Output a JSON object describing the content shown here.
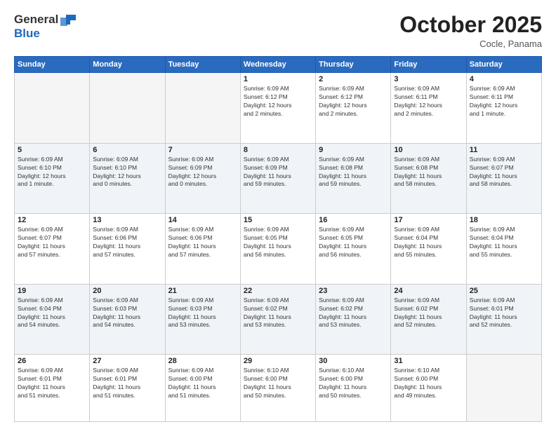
{
  "header": {
    "logo_general": "General",
    "logo_blue": "Blue",
    "month_title": "October 2025",
    "subtitle": "Cocle, Panama"
  },
  "weekdays": [
    "Sunday",
    "Monday",
    "Tuesday",
    "Wednesday",
    "Thursday",
    "Friday",
    "Saturday"
  ],
  "weeks": [
    [
      {
        "day": "",
        "info": ""
      },
      {
        "day": "",
        "info": ""
      },
      {
        "day": "",
        "info": ""
      },
      {
        "day": "1",
        "info": "Sunrise: 6:09 AM\nSunset: 6:12 PM\nDaylight: 12 hours\nand 2 minutes."
      },
      {
        "day": "2",
        "info": "Sunrise: 6:09 AM\nSunset: 6:12 PM\nDaylight: 12 hours\nand 2 minutes."
      },
      {
        "day": "3",
        "info": "Sunrise: 6:09 AM\nSunset: 6:11 PM\nDaylight: 12 hours\nand 2 minutes."
      },
      {
        "day": "4",
        "info": "Sunrise: 6:09 AM\nSunset: 6:11 PM\nDaylight: 12 hours\nand 1 minute."
      }
    ],
    [
      {
        "day": "5",
        "info": "Sunrise: 6:09 AM\nSunset: 6:10 PM\nDaylight: 12 hours\nand 1 minute."
      },
      {
        "day": "6",
        "info": "Sunrise: 6:09 AM\nSunset: 6:10 PM\nDaylight: 12 hours\nand 0 minutes."
      },
      {
        "day": "7",
        "info": "Sunrise: 6:09 AM\nSunset: 6:09 PM\nDaylight: 12 hours\nand 0 minutes."
      },
      {
        "day": "8",
        "info": "Sunrise: 6:09 AM\nSunset: 6:09 PM\nDaylight: 11 hours\nand 59 minutes."
      },
      {
        "day": "9",
        "info": "Sunrise: 6:09 AM\nSunset: 6:08 PM\nDaylight: 11 hours\nand 59 minutes."
      },
      {
        "day": "10",
        "info": "Sunrise: 6:09 AM\nSunset: 6:08 PM\nDaylight: 11 hours\nand 58 minutes."
      },
      {
        "day": "11",
        "info": "Sunrise: 6:09 AM\nSunset: 6:07 PM\nDaylight: 11 hours\nand 58 minutes."
      }
    ],
    [
      {
        "day": "12",
        "info": "Sunrise: 6:09 AM\nSunset: 6:07 PM\nDaylight: 11 hours\nand 57 minutes."
      },
      {
        "day": "13",
        "info": "Sunrise: 6:09 AM\nSunset: 6:06 PM\nDaylight: 11 hours\nand 57 minutes."
      },
      {
        "day": "14",
        "info": "Sunrise: 6:09 AM\nSunset: 6:06 PM\nDaylight: 11 hours\nand 57 minutes."
      },
      {
        "day": "15",
        "info": "Sunrise: 6:09 AM\nSunset: 6:05 PM\nDaylight: 11 hours\nand 56 minutes."
      },
      {
        "day": "16",
        "info": "Sunrise: 6:09 AM\nSunset: 6:05 PM\nDaylight: 11 hours\nand 56 minutes."
      },
      {
        "day": "17",
        "info": "Sunrise: 6:09 AM\nSunset: 6:04 PM\nDaylight: 11 hours\nand 55 minutes."
      },
      {
        "day": "18",
        "info": "Sunrise: 6:09 AM\nSunset: 6:04 PM\nDaylight: 11 hours\nand 55 minutes."
      }
    ],
    [
      {
        "day": "19",
        "info": "Sunrise: 6:09 AM\nSunset: 6:04 PM\nDaylight: 11 hours\nand 54 minutes."
      },
      {
        "day": "20",
        "info": "Sunrise: 6:09 AM\nSunset: 6:03 PM\nDaylight: 11 hours\nand 54 minutes."
      },
      {
        "day": "21",
        "info": "Sunrise: 6:09 AM\nSunset: 6:03 PM\nDaylight: 11 hours\nand 53 minutes."
      },
      {
        "day": "22",
        "info": "Sunrise: 6:09 AM\nSunset: 6:02 PM\nDaylight: 11 hours\nand 53 minutes."
      },
      {
        "day": "23",
        "info": "Sunrise: 6:09 AM\nSunset: 6:02 PM\nDaylight: 11 hours\nand 53 minutes."
      },
      {
        "day": "24",
        "info": "Sunrise: 6:09 AM\nSunset: 6:02 PM\nDaylight: 11 hours\nand 52 minutes."
      },
      {
        "day": "25",
        "info": "Sunrise: 6:09 AM\nSunset: 6:01 PM\nDaylight: 11 hours\nand 52 minutes."
      }
    ],
    [
      {
        "day": "26",
        "info": "Sunrise: 6:09 AM\nSunset: 6:01 PM\nDaylight: 11 hours\nand 51 minutes."
      },
      {
        "day": "27",
        "info": "Sunrise: 6:09 AM\nSunset: 6:01 PM\nDaylight: 11 hours\nand 51 minutes."
      },
      {
        "day": "28",
        "info": "Sunrise: 6:09 AM\nSunset: 6:00 PM\nDaylight: 11 hours\nand 51 minutes."
      },
      {
        "day": "29",
        "info": "Sunrise: 6:10 AM\nSunset: 6:00 PM\nDaylight: 11 hours\nand 50 minutes."
      },
      {
        "day": "30",
        "info": "Sunrise: 6:10 AM\nSunset: 6:00 PM\nDaylight: 11 hours\nand 50 minutes."
      },
      {
        "day": "31",
        "info": "Sunrise: 6:10 AM\nSunset: 6:00 PM\nDaylight: 11 hours\nand 49 minutes."
      },
      {
        "day": "",
        "info": ""
      }
    ]
  ]
}
